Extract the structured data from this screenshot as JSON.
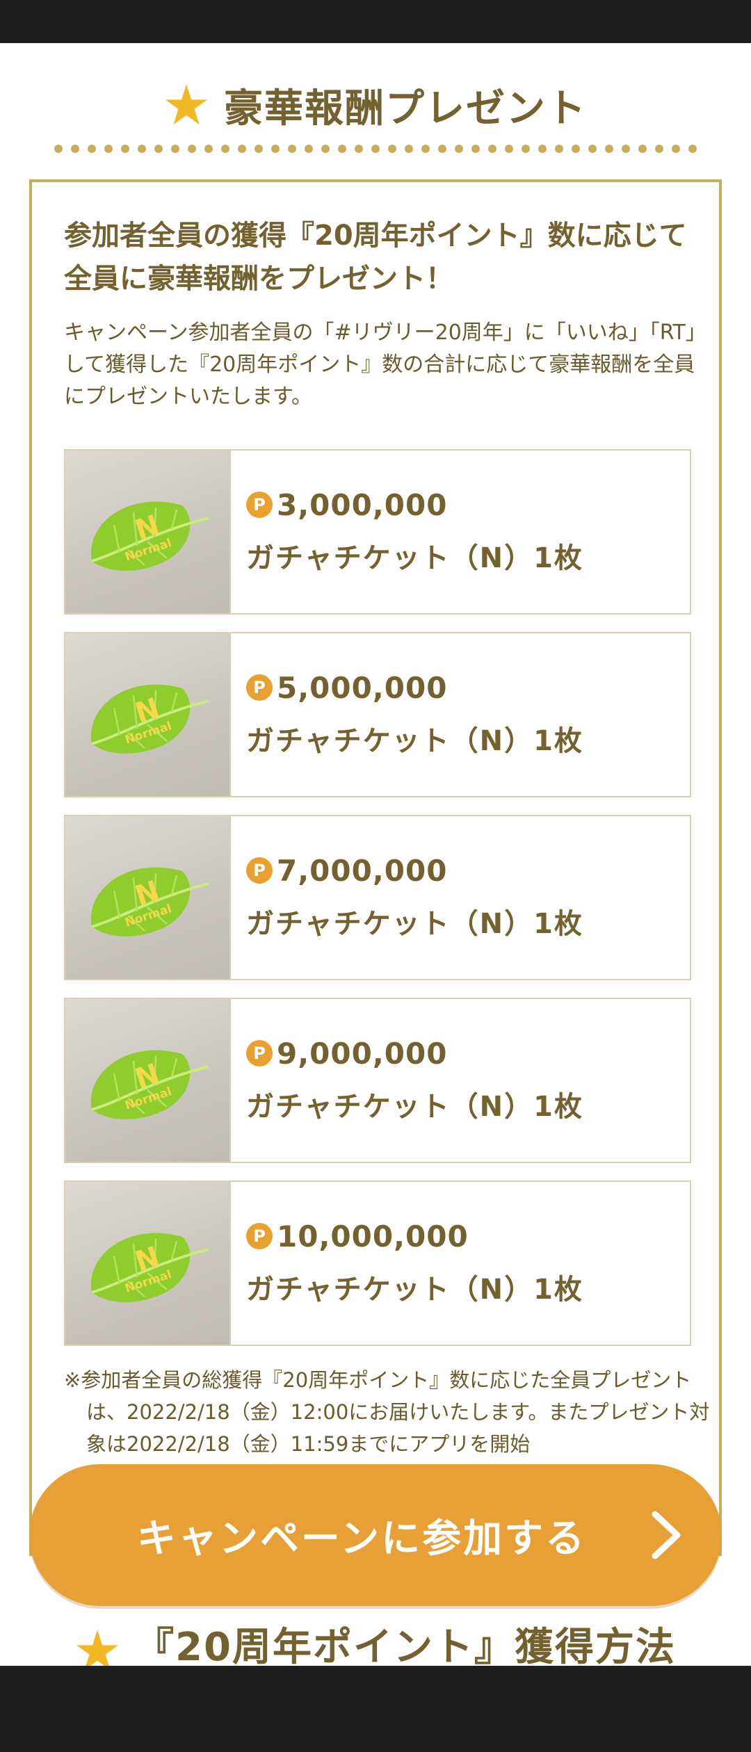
{
  "header": {
    "title": "豪華報酬プレゼント",
    "accent_color": "#f2b824"
  },
  "panel": {
    "lead": "参加者全員の獲得『20周年ポイント』数に応じて全員に豪華報酬をプレゼント！",
    "description": "キャンペーン参加者全員の「#リヴリー20周年」に「いいね」「RT」して獲得した『20周年ポイント』数の合計に応じて豪華報酬を全員にプレゼントいたします。",
    "rewards": [
      {
        "points": "3,000,000",
        "name": "ガチャチケット（N）1枚",
        "badge": "P",
        "image_icon": "normal-leaf-icon"
      },
      {
        "points": "5,000,000",
        "name": "ガチャチケット（N）1枚",
        "badge": "P",
        "image_icon": "normal-leaf-icon"
      },
      {
        "points": "7,000,000",
        "name": "ガチャチケット（N）1枚",
        "badge": "P",
        "image_icon": "normal-leaf-icon"
      },
      {
        "points": "9,000,000",
        "name": "ガチャチケット（N）1枚",
        "badge": "P",
        "image_icon": "normal-leaf-icon"
      },
      {
        "points": "10,000,000",
        "name": "ガチャチケット（N）1枚",
        "badge": "P",
        "image_icon": "normal-leaf-icon"
      }
    ],
    "note": "※参加者全員の総獲得『20周年ポイント』数に応じた全員プレゼントは、2022/2/18（金）12:00にお届けいたします。またプレゼント対象は2022/2/18（金）11:59までにアプリを開始"
  },
  "join_button": {
    "label": "キャンペーンに参加する",
    "color": "#e7a035"
  },
  "section2": {
    "title": "『20周年ポイント』獲得方法"
  }
}
